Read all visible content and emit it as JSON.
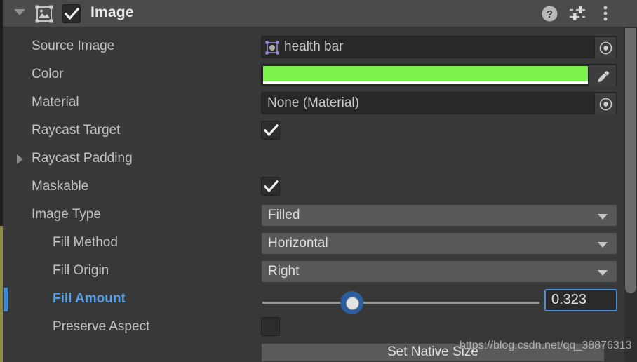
{
  "component": {
    "title": "Image",
    "enabled": true,
    "expanded": true,
    "icon": "image-component-icon",
    "header_buttons": [
      {
        "name": "help-icon",
        "label": "?"
      },
      {
        "name": "preset-icon",
        "label": ""
      },
      {
        "name": "more-menu-icon",
        "label": ""
      }
    ]
  },
  "colors": {
    "panel_background": "#383838",
    "header_background": "#4a4a4a",
    "field_background": "#282828",
    "dropdown_background": "#585858",
    "accent_blue": "#5a9fe2",
    "marker_blue": "#3c88d8",
    "olive_edge": "#8c8b3f",
    "image_color_value": "#7cf24f",
    "alpha_bar": "#ffffff"
  },
  "properties": {
    "source_image": {
      "label": "Source Image",
      "value": "health bar",
      "icon": "sprite-icon",
      "picker": "object-picker-icon"
    },
    "color": {
      "label": "Color",
      "value": "#7cf24f",
      "alpha": "#ffffff",
      "picker": "eyedropper-icon"
    },
    "material": {
      "label": "Material",
      "value": "None (Material)",
      "picker": "object-picker-icon"
    },
    "raycast_target": {
      "label": "Raycast Target",
      "checked": true
    },
    "raycast_padding": {
      "label": "Raycast Padding",
      "expanded": false
    },
    "maskable": {
      "label": "Maskable",
      "checked": true
    },
    "image_type": {
      "label": "Image Type",
      "value": "Filled"
    },
    "fill_method": {
      "label": "Fill Method",
      "value": "Horizontal"
    },
    "fill_origin": {
      "label": "Fill Origin",
      "value": "Right"
    },
    "fill_amount": {
      "label": "Fill Amount",
      "value": "0.323",
      "highlighted": true,
      "slider_percent": 32.3
    },
    "preserve_aspect": {
      "label": "Preserve Aspect",
      "checked": false
    }
  },
  "actions": {
    "set_native_size": "Set Native Size"
  },
  "watermark": "https://blog.csdn.net/qq_38876313"
}
